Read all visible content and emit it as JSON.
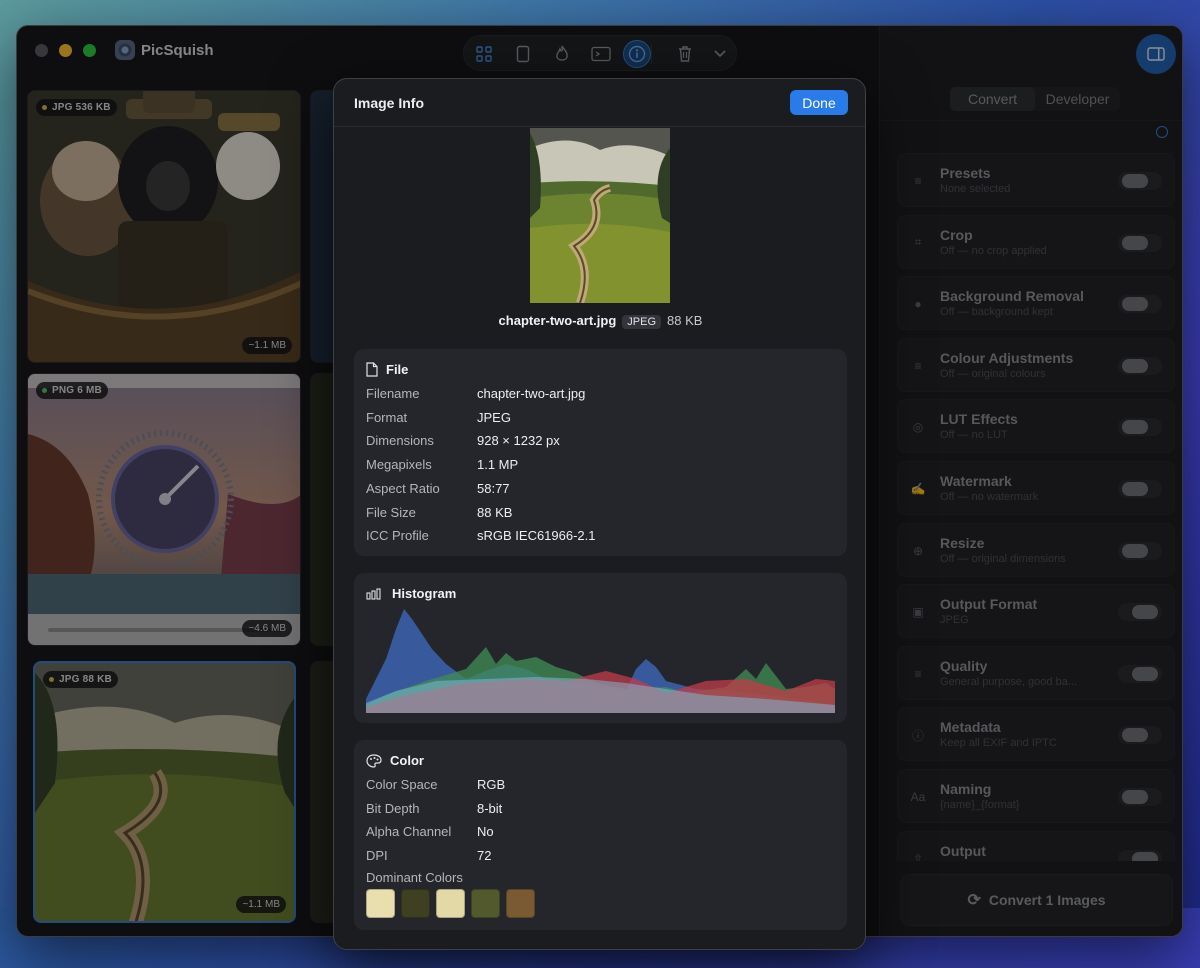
{
  "app": {
    "title": "PicSquish"
  },
  "toolbar": {
    "buttons": [
      "grid-view",
      "single-view",
      "flame",
      "terminal",
      "info",
      "trash",
      "more-options"
    ]
  },
  "gallery": {
    "items": [
      {
        "format": "JPG",
        "size": "536 KB",
        "estimate": "~1.1 MB",
        "dot_color": "#d8b44a"
      },
      {
        "format": "PNG",
        "size": "6 MB",
        "estimate": "~4.6 MB",
        "dot_color": "#5bbf5a"
      },
      {
        "format": "JPG",
        "size": "88 KB",
        "estimate": "~1.1 MB",
        "dot_color": "#d8b44a",
        "selected": true
      }
    ]
  },
  "panel": {
    "tabs": [
      "Convert",
      "Developer"
    ],
    "active_tab": "Convert",
    "items": [
      {
        "title": "Presets",
        "subtitle": "None selected",
        "icon": "sliders-icon",
        "on": false
      },
      {
        "title": "Crop",
        "subtitle": "Off — no crop applied",
        "icon": "crop-icon",
        "on": false
      },
      {
        "title": "Background Removal",
        "subtitle": "Off — background kept",
        "icon": "person-icon",
        "on": false
      },
      {
        "title": "Colour Adjustments",
        "subtitle": "Off — original colours",
        "icon": "sliders-icon",
        "on": false
      },
      {
        "title": "LUT Effects",
        "subtitle": "Off — no LUT",
        "icon": "lut-icon",
        "on": false
      },
      {
        "title": "Watermark",
        "subtitle": "Off — no watermark",
        "icon": "signature-icon",
        "on": false
      },
      {
        "title": "Resize",
        "subtitle": "Off — original dimensions",
        "icon": "zoom-icon",
        "on": false
      },
      {
        "title": "Output Format",
        "subtitle": "JPEG",
        "icon": "image-format-icon",
        "on": true
      },
      {
        "title": "Quality",
        "subtitle": "General purpose, good ba...",
        "icon": "sliders-icon",
        "on": true
      },
      {
        "title": "Metadata",
        "subtitle": "Keep all EXIF and IPTC",
        "icon": "info-icon",
        "on": false
      },
      {
        "title": "Naming",
        "subtitle": "{name}_{format}",
        "icon": "text-icon",
        "on": false
      },
      {
        "title": "Output",
        "subtitle": "",
        "icon": "upload-icon",
        "on": true
      }
    ],
    "convert_label": "Convert 1 Images"
  },
  "modal": {
    "title": "Image Info",
    "done_label": "Done",
    "filename": "chapter-two-art.jpg",
    "format_badge": "JPEG",
    "filesize": "88 KB",
    "file": {
      "heading": "File",
      "rows": [
        {
          "k": "Filename",
          "v": "chapter-two-art.jpg"
        },
        {
          "k": "Format",
          "v": "JPEG"
        },
        {
          "k": "Dimensions",
          "v": "928 × 1232 px"
        },
        {
          "k": "Megapixels",
          "v": "1.1 MP"
        },
        {
          "k": "Aspect Ratio",
          "v": "58:77"
        },
        {
          "k": "File Size",
          "v": "88 KB"
        },
        {
          "k": "ICC Profile",
          "v": "sRGB IEC61966-2.1"
        }
      ]
    },
    "histogram": {
      "heading": "Histogram"
    },
    "color": {
      "heading": "Color",
      "rows": [
        {
          "k": "Color Space",
          "v": "RGB"
        },
        {
          "k": "Bit Depth",
          "v": "8-bit"
        },
        {
          "k": "Alpha Channel",
          "v": "No"
        },
        {
          "k": "DPI",
          "v": "72"
        }
      ],
      "dominant_label": "Dominant Colors",
      "dominant": [
        "#e8deae",
        "#3f3f22",
        "#e3d9a7",
        "#525a2d",
        "#7a5a33"
      ]
    }
  }
}
